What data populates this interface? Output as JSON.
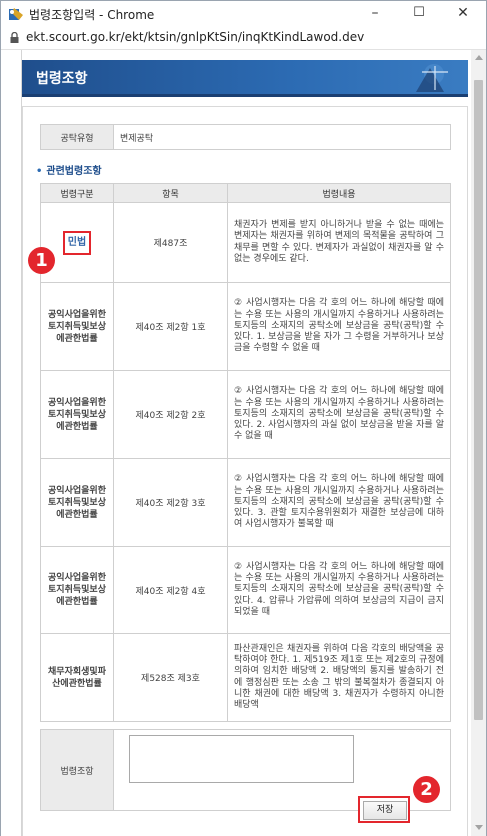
{
  "window": {
    "title": "법령조항입력 - Chrome",
    "url": "ekt.scourt.go.kr/ekt/ktsin/gnlpKtSin/inqKtKindLawod.dev",
    "controls": [
      "–",
      "☐",
      "✕"
    ]
  },
  "page": {
    "header_title": "법령조항",
    "deposit_type_label": "공탁유형",
    "deposit_type_value": "변제공탁",
    "section_title": "관련법령조항",
    "table_headers": [
      "법령구분",
      "항목",
      "법령내용"
    ],
    "rows": [
      {
        "law": "민법",
        "article": "제487조",
        "content": "채권자가 변제를 받지 아니하거나 받을 수 없는 때에는 변제자는 채권자를 위하여 변제의 목적물을 공탁하여 그 채무를 면할 수 있다. 변제자가 과실없이 채권자를 알 수 없는 경우에도 같다."
      },
      {
        "law": "공익사업을위한토지취득및보상에관한법률",
        "article": "제40조 제2항 1호",
        "content": "② 사업시행자는 다음 각 호의 어느 하나에 해당할 때에는 수용 또는 사용의 개시일까지 수용하거나 사용하려는 토지등의 소재지의 공탁소에 보상금을 공탁(공탁)할 수 있다. 1. 보상금을 받을 자가 그 수령을 거부하거나 보상금을 수령할 수 없을 때"
      },
      {
        "law": "공익사업을위한토지취득및보상에관한법률",
        "article": "제40조 제2항 2호",
        "content": "② 사업시행자는 다음 각 호의 어느 하나에 해당할 때에는 수용 또는 사용의 개시일까지 수용하거나 사용하려는 토지등의 소재지의 공탁소에 보상금을 공탁(공탁)할 수 있다. 2. 사업시행자의 과실 없이 보상금을 받을 자를 알 수 없을 때"
      },
      {
        "law": "공익사업을위한토지취득및보상에관한법률",
        "article": "제40조 제2항 3호",
        "content": "② 사업시행자는 다음 각 호의 어느 하나에 해당할 때에는 수용 또는 사용의 개시일까지 수용하거나 사용하려는 토지등의 소재지의 공탁소에 보상금을 공탁(공탁)할 수 있다. 3. 관할 토지수용위원회가 재결한 보상금에 대하여 사업시행자가 불복할 때"
      },
      {
        "law": "공익사업을위한토지취득및보상에관한법률",
        "article": "제40조 제2항 4호",
        "content": "② 사업시행자는 다음 각 호의 어느 하나에 해당할 때에는 수용 또는 사용의 개시일까지 수용하거나 사용하려는 토지등의 소재지의 공탁소에 보상금을 공탁(공탁)할 수 있다. 4. 압류나 가압류에 의하여 보상금의 지급이 금지되었을 때"
      },
      {
        "law": "채무자회생및파산에관한법률",
        "article": "제528조 제3호",
        "content": "파산관재인은 채권자를 위하여 다음 각호의 배당액을 공탁하여야 한다. 1. 제519조 제1호 또는 제2호의 규정에 의하여 임치한 배당액 2. 배당액의 통지를 발송하기 전에 행정심판 또는 소송 그 밖의 불복절차가 종결되지 아니한 채권에 대한 배당액 3. 채권자가 수령하지 아니한 배당액"
      }
    ],
    "law_clause_label": "법령조항",
    "law_clause_value": "",
    "save_label": "저장",
    "badge1": "1",
    "badge2": "2"
  },
  "colors": {
    "header_blue": "#2c6bb3",
    "law_text": "#3467a8",
    "highlight_red": "#e3262d"
  }
}
